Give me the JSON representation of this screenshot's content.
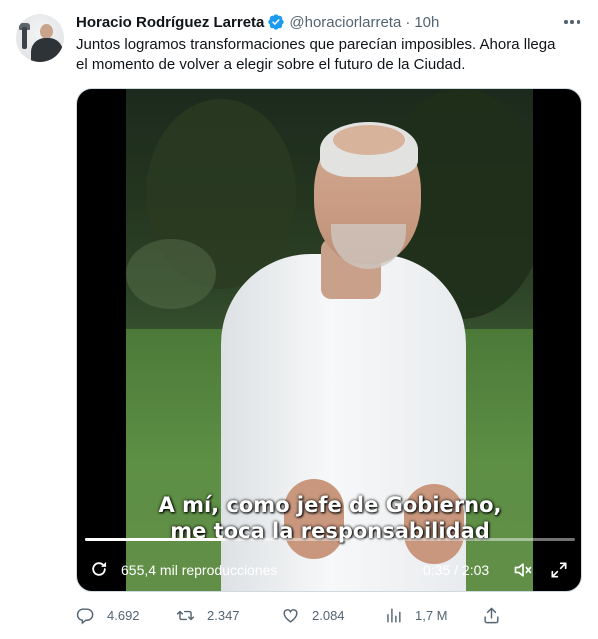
{
  "tweet": {
    "author": {
      "display_name": "Horacio Rodríguez Larreta",
      "handle": "@horaciorlarreta",
      "verified": true,
      "avatar_icon": "profile-photo"
    },
    "separator": "·",
    "time": "10h",
    "text_lines": [
      "Juntos logramos transformaciones que parecían imposibles. Ahora llega",
      "el momento de volver a elegir sobre el futuro de la Ciudad."
    ],
    "media": {
      "type": "video",
      "subtitle_lines": [
        "A mí, como jefe de Gobierno,",
        "me toca la responsabilidad"
      ],
      "views_label": "655,4 mil reproducciones",
      "timecode": "0:35 / 2:03",
      "progress_fraction": 0.285
    },
    "actions": {
      "reply_count": "4.692",
      "retweet_count": "2.347",
      "like_count": "2.084",
      "views_count": "1,7 M"
    },
    "colors": {
      "verified_blue": "#1d9bf0",
      "secondary_text": "#536471",
      "primary_text": "#0f1419"
    }
  }
}
